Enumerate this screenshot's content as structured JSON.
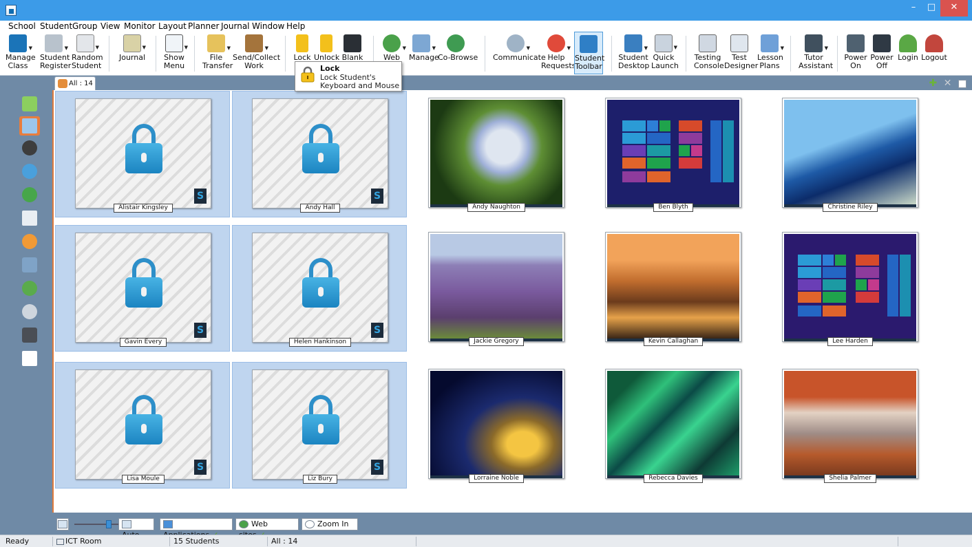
{
  "window": {
    "minimize": "–",
    "maximize": "□",
    "close": "✕"
  },
  "menu": [
    "School",
    "Student",
    "Group",
    "View",
    "Monitor",
    "Layout",
    "Planner",
    "Journal",
    "Window",
    "Help"
  ],
  "toolbar": [
    {
      "line1": "Manage",
      "line2": "Class",
      "icon": "manage-class-icon"
    },
    {
      "line1": "Student",
      "line2": "Register",
      "icon": "student-register-icon"
    },
    {
      "line1": "Random",
      "line2": "Student",
      "icon": "random-student-icon"
    },
    {
      "line1": "Journal",
      "line2": "",
      "icon": "journal-icon"
    },
    {
      "line1": "Show",
      "line2": "Menu",
      "icon": "show-menu-icon"
    },
    {
      "line1": "File",
      "line2": "Transfer",
      "icon": "file-transfer-icon"
    },
    {
      "line1": "Send/Collect",
      "line2": "Work",
      "icon": "send-collect-icon"
    },
    {
      "line1": "Lock",
      "line2": "",
      "icon": "lock-icon"
    },
    {
      "line1": "Unlock",
      "line2": "",
      "icon": "unlock-icon"
    },
    {
      "line1": "Blank",
      "line2": "",
      "icon": "blank-icon"
    },
    {
      "line1": "Web",
      "line2": "",
      "icon": "web-icon"
    },
    {
      "line1": "Manage",
      "line2": "",
      "icon": "manage-icon"
    },
    {
      "line1": "Co-Browse",
      "line2": "",
      "icon": "co-browse-icon"
    },
    {
      "line1": "Communicate",
      "line2": "",
      "icon": "communicate-icon"
    },
    {
      "line1": "Help",
      "line2": "Requests",
      "icon": "help-requests-icon"
    },
    {
      "line1": "Student",
      "line2": "Toolbar",
      "icon": "student-toolbar-icon"
    },
    {
      "line1": "Student",
      "line2": "Desktop",
      "icon": "student-desktop-icon"
    },
    {
      "line1": "Quick",
      "line2": "Launch",
      "icon": "quick-launch-icon"
    },
    {
      "line1": "Testing",
      "line2": "Console",
      "icon": "testing-console-icon"
    },
    {
      "line1": "Test",
      "line2": "Designer",
      "icon": "test-designer-icon"
    },
    {
      "line1": "Lesson",
      "line2": "Plans",
      "icon": "lesson-plans-icon"
    },
    {
      "line1": "Tutor",
      "line2": "Assistant",
      "icon": "tutor-assistant-icon"
    },
    {
      "line1": "Power",
      "line2": "On",
      "icon": "power-on-icon"
    },
    {
      "line1": "Power",
      "line2": "Off",
      "icon": "power-off-icon"
    },
    {
      "line1": "Login",
      "line2": "",
      "icon": "login-icon"
    },
    {
      "line1": "Logout",
      "line2": "",
      "icon": "logout-icon"
    }
  ],
  "tooltip": {
    "title": "Lock",
    "description": "Lock Student's Keyboard and Mouse"
  },
  "tab": {
    "label": "All : 14"
  },
  "students": [
    {
      "name": "Alistair Kingsley",
      "locked": true
    },
    {
      "name": "Andy Hall",
      "locked": true
    },
    {
      "name": "Andy Naughton",
      "locked": false,
      "screen": "hydrangea"
    },
    {
      "name": "Ben Blyth",
      "locked": false,
      "screen": "start"
    },
    {
      "name": "Christine Riley",
      "locked": false,
      "screen": "architecture"
    },
    {
      "name": "Gavin Every",
      "locked": true
    },
    {
      "name": "Helen Hankinson",
      "locked": true
    },
    {
      "name": "Jackie Gregory",
      "locked": false,
      "screen": "lavender"
    },
    {
      "name": "Kevin Callaghan",
      "locked": false,
      "screen": "coast"
    },
    {
      "name": "Lee Harden",
      "locked": false,
      "screen": "start"
    },
    {
      "name": "Lisa Moule",
      "locked": true
    },
    {
      "name": "Liz Bury",
      "locked": true
    },
    {
      "name": "Lorraine Noble",
      "locked": false,
      "screen": "bridge"
    },
    {
      "name": "Rebecca Davies",
      "locked": false,
      "screen": "leaves"
    },
    {
      "name": "Shelia Palmer",
      "locked": false,
      "screen": "arch"
    }
  ],
  "bottombar": {
    "auto": "Auto",
    "applications": "Applications",
    "websites": "Web sites",
    "zoom": "Zoom In"
  },
  "status": {
    "state": "Ready",
    "room": "ICT Room",
    "students": "15 Students",
    "group": "All : 14"
  },
  "colors": {
    "titlebar": "#3c9be8",
    "accent": "#e87d3e",
    "selection": "#bfd5ef",
    "lock": "#2d8fc9"
  }
}
